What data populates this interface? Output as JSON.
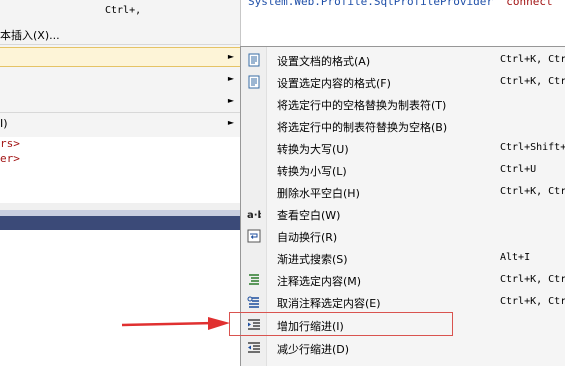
{
  "left_menu": {
    "shortcut_top": "Ctrl+,",
    "insert_label": "本插入(X)...",
    "item_i_label": "I)"
  },
  "editor": {
    "code_line": "System.Web.Profile.SqlProfileProvider",
    "code_string": "\"connect"
  },
  "code_lines": [
    "rs>",
    "er>"
  ],
  "submenu": {
    "items": [
      {
        "label": "设置文档的格式(A)",
        "shortcut": "Ctrl+K, Ctr",
        "icon": "format-document-icon"
      },
      {
        "label": "设置选定内容的格式(F)",
        "shortcut": "Ctrl+K, Ctr",
        "icon": "format-selection-icon"
      },
      {
        "label": "将选定行中的空格替换为制表符(T)",
        "shortcut": "",
        "icon": ""
      },
      {
        "label": "将选定行中的制表符替换为空格(B)",
        "shortcut": "",
        "icon": ""
      },
      {
        "label": "转换为大写(U)",
        "shortcut": "Ctrl+Shift+",
        "icon": ""
      },
      {
        "label": "转换为小写(L)",
        "shortcut": "Ctrl+U",
        "icon": ""
      },
      {
        "label": "删除水平空白(H)",
        "shortcut": "Ctrl+K, Ctr",
        "icon": ""
      },
      {
        "label": "查看空白(W)",
        "shortcut": "",
        "icon": "view-whitespace-icon"
      },
      {
        "label": "自动换行(R)",
        "shortcut": "",
        "icon": "word-wrap-icon"
      },
      {
        "label": "渐进式搜索(S)",
        "shortcut": "Alt+I",
        "icon": ""
      },
      {
        "label": "注释选定内容(M)",
        "shortcut": "Ctrl+K, Ctr",
        "icon": "comment-icon"
      },
      {
        "label": "取消注释选定内容(E)",
        "shortcut": "Ctrl+K, Ctr",
        "icon": "uncomment-icon"
      },
      {
        "label": "增加行缩进(I)",
        "shortcut": "",
        "icon": "increase-indent-icon"
      },
      {
        "label": "减少行缩进(D)",
        "shortcut": "",
        "icon": "decrease-indent-icon"
      }
    ]
  },
  "colors": {
    "highlight_box": "#d9534f",
    "arrow": "#e03030"
  }
}
